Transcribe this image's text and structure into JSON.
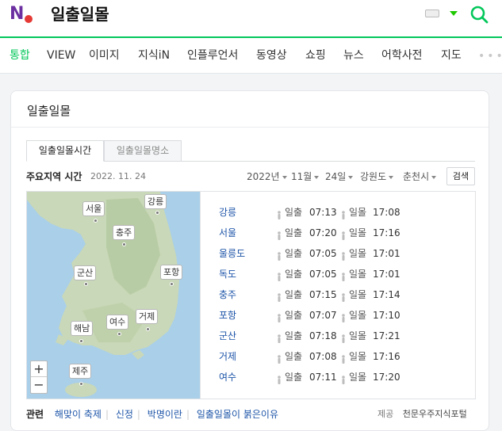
{
  "header": {
    "logo_letter": "N",
    "query": "일출일몰"
  },
  "colors": {
    "accent": "#03c75a",
    "link": "#1e55a8",
    "map_sea": "#a9cfe9",
    "map_land": "#c9d8b8"
  },
  "tabs": [
    {
      "label": "통합",
      "active": true
    },
    {
      "label": "VIEW",
      "active": false
    },
    {
      "label": "이미지",
      "active": false
    },
    {
      "label": "지식iN",
      "active": false
    },
    {
      "label": "인플루언서",
      "active": false
    },
    {
      "label": "동영상",
      "active": false
    },
    {
      "label": "쇼핑",
      "active": false
    },
    {
      "label": "뉴스",
      "active": false
    },
    {
      "label": "어학사전",
      "active": false
    },
    {
      "label": "지도",
      "active": false
    }
  ],
  "card": {
    "title": "일출일몰",
    "subtabs": [
      "일출일몰시간",
      "일출일몰명소"
    ],
    "region_label": "주요지역 시간",
    "date": "2022. 11. 24",
    "selectors": {
      "year": "2022년",
      "month": "11월",
      "day": "24일",
      "province": "강원도",
      "city": "춘천시"
    },
    "search_button": "검색",
    "zoom_in": "+",
    "zoom_out": "−",
    "map_pins": [
      "강릉",
      "서울",
      "충주",
      "군산",
      "포항",
      "해남",
      "여수",
      "거제",
      "제주"
    ],
    "sunrise_label": "일출",
    "sunset_label": "일몰",
    "rows": [
      {
        "city": "강릉",
        "sunrise": "07:13",
        "sunset": "17:08"
      },
      {
        "city": "서울",
        "sunrise": "07:20",
        "sunset": "17:16"
      },
      {
        "city": "울릉도",
        "sunrise": "07:05",
        "sunset": "17:01"
      },
      {
        "city": "독도",
        "sunrise": "07:05",
        "sunset": "17:01"
      },
      {
        "city": "충주",
        "sunrise": "07:15",
        "sunset": "17:14"
      },
      {
        "city": "포항",
        "sunrise": "07:07",
        "sunset": "17:10"
      },
      {
        "city": "군산",
        "sunrise": "07:18",
        "sunset": "17:21"
      },
      {
        "city": "거제",
        "sunrise": "07:08",
        "sunset": "17:16"
      },
      {
        "city": "여수",
        "sunrise": "07:11",
        "sunset": "17:20"
      }
    ],
    "related_label": "관련",
    "related": [
      "해맞이 축제",
      "신정",
      "박명이란",
      "일출일몰이 붉은이유"
    ],
    "provider_label": "제공",
    "provider": "천문우주지식포털"
  }
}
